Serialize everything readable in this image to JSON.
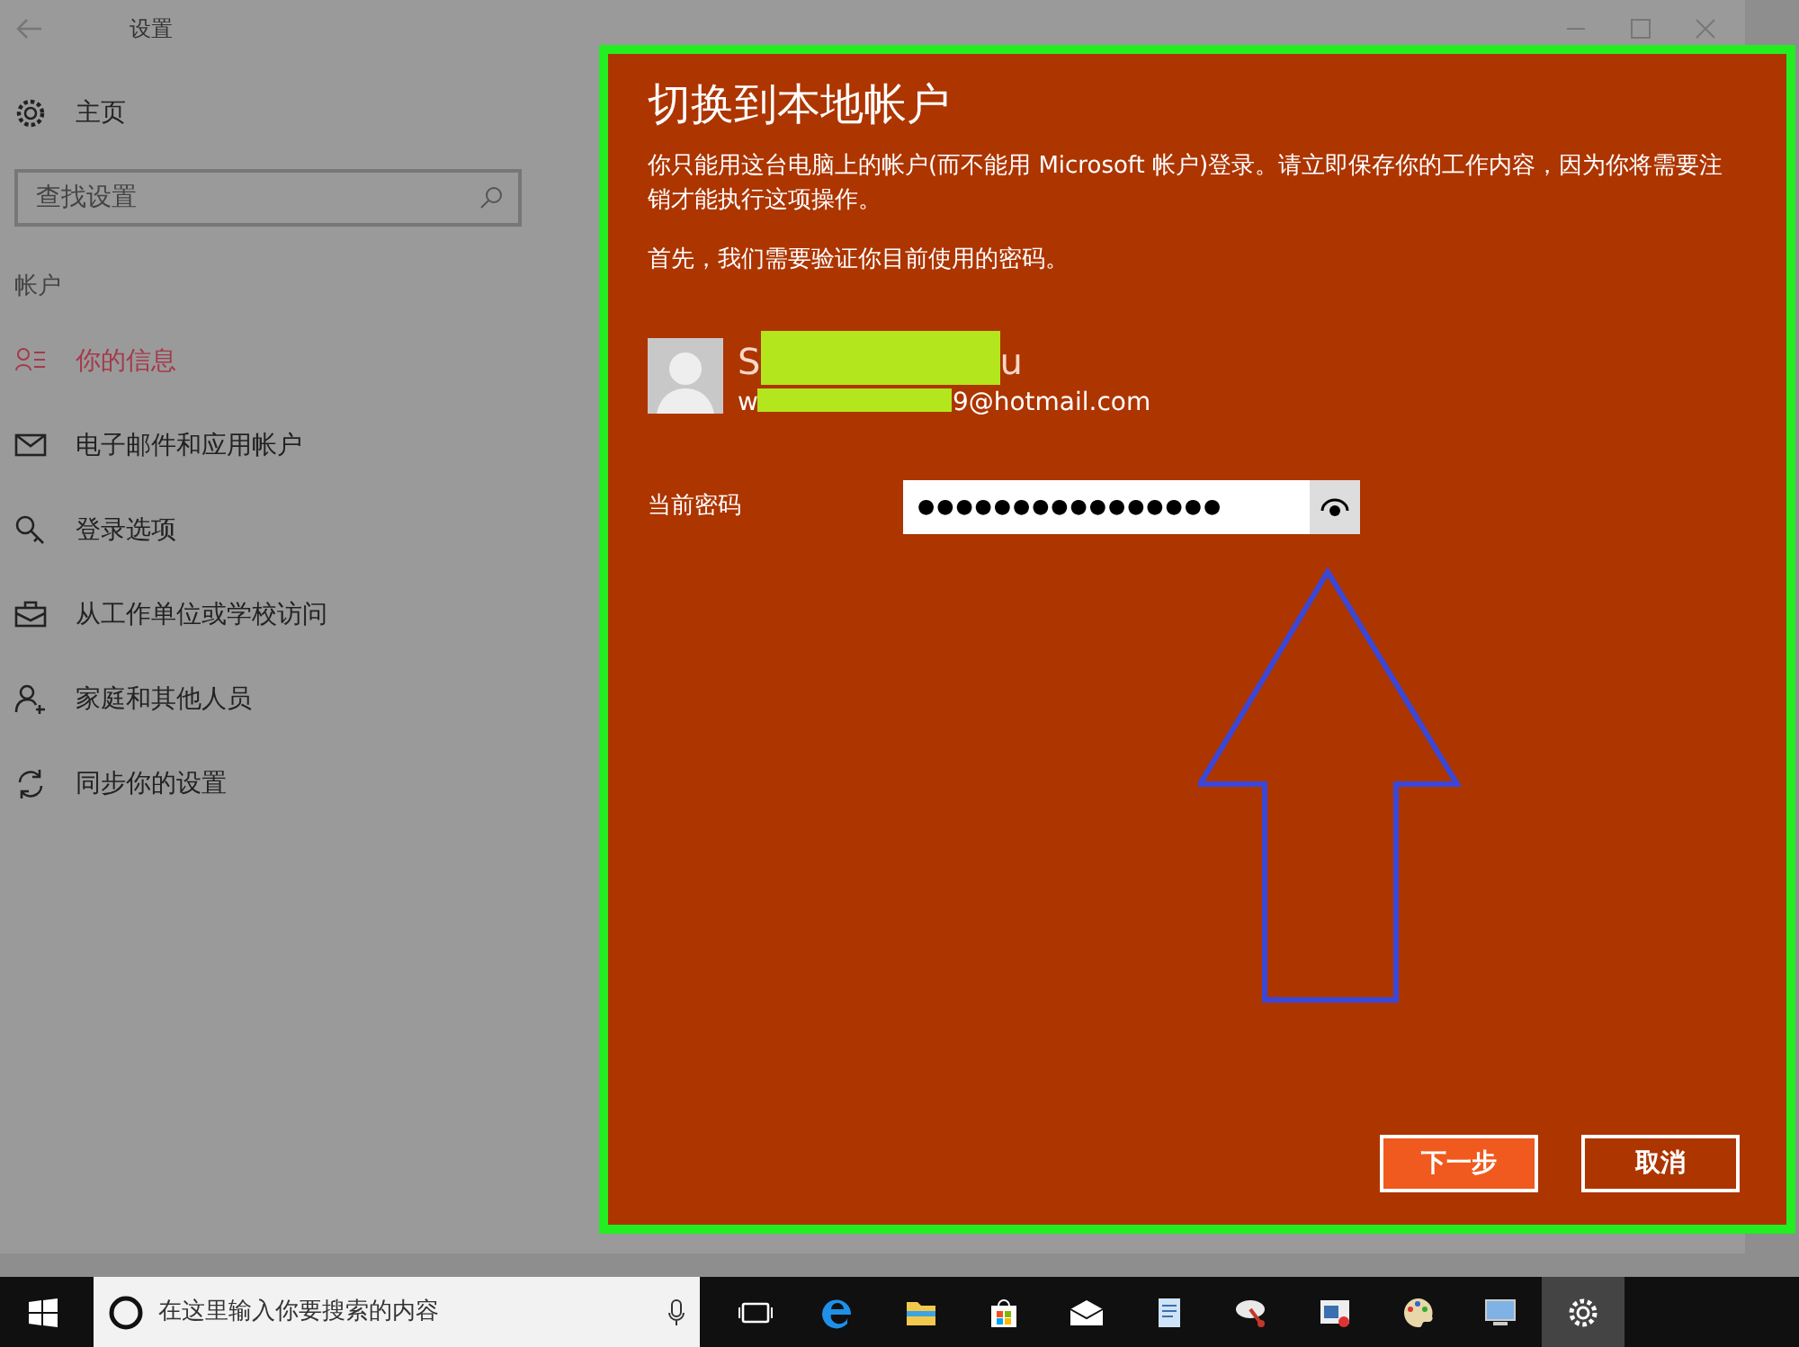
{
  "window": {
    "title": "设置"
  },
  "sidebar": {
    "home": "主页",
    "search": {
      "placeholder": "查找设置"
    },
    "section": "帐户",
    "items": [
      {
        "label": "你的信息",
        "kind": "profile",
        "selected": true
      },
      {
        "label": "电子邮件和应用帐户",
        "kind": "mail",
        "selected": false
      },
      {
        "label": "登录选项",
        "kind": "key",
        "selected": false
      },
      {
        "label": "从工作单位或学校访问",
        "kind": "work",
        "selected": false
      },
      {
        "label": "家庭和其他人员",
        "kind": "family",
        "selected": false
      },
      {
        "label": "同步你的设置",
        "kind": "sync",
        "selected": false
      }
    ]
  },
  "dialog": {
    "title": "切换到本地帐户",
    "paragraphs": [
      "你只能用这台电脑上的帐户(而不能用 Microsoft 帐户)登录。请立即保存你的工作内容，因为你将需要注销才能执行这项操作。",
      "首先，我们需要验证你目前使用的密码。"
    ],
    "user": {
      "name_start": "S",
      "name_end": "u",
      "email_start": "w",
      "email_end": "9@hotmail.com"
    },
    "password": {
      "label": "当前密码",
      "value": "●●●●●●●●●●●●●●●●"
    },
    "buttons": [
      {
        "label": "下一步",
        "primary": true
      },
      {
        "label": "取消",
        "primary": false
      }
    ]
  },
  "taskbar": {
    "search": {
      "placeholder": "在这里输入你要搜索的内容"
    },
    "apps": [
      {
        "kind": "taskview",
        "active": false
      },
      {
        "kind": "edge",
        "active": false
      },
      {
        "kind": "folder",
        "active": false
      },
      {
        "kind": "store",
        "active": false
      },
      {
        "kind": "mail",
        "active": false
      },
      {
        "kind": "document",
        "active": false
      },
      {
        "kind": "satellite",
        "active": false
      },
      {
        "kind": "media",
        "active": false
      },
      {
        "kind": "paint",
        "active": false
      },
      {
        "kind": "computer",
        "active": false
      },
      {
        "kind": "settings",
        "active": true
      }
    ]
  }
}
